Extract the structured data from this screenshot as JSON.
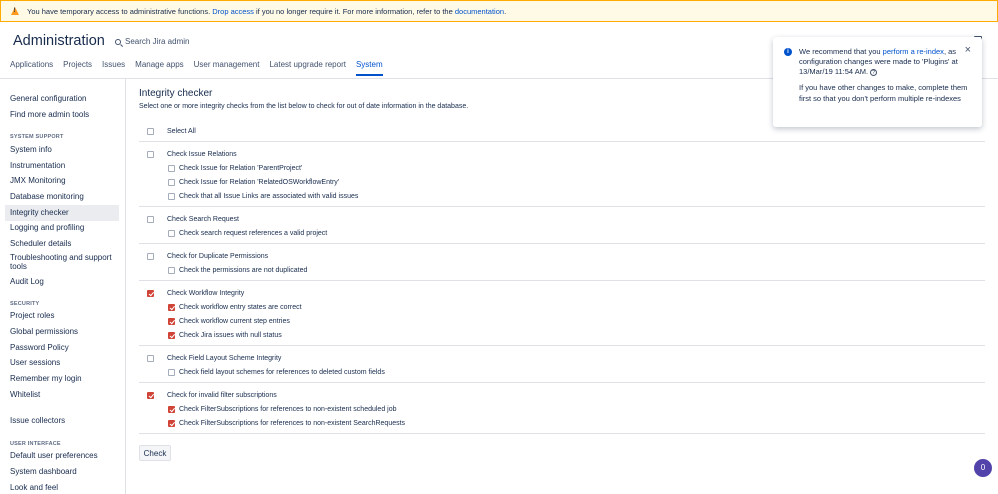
{
  "banner": {
    "icon": "warning-icon",
    "text_before": "You have temporary access to administrative functions. ",
    "link_drop": "Drop access",
    "text_middle": " if you no longer require it. For more information, refer to the ",
    "link_docs": "documentation",
    "text_after": "."
  },
  "header": {
    "title": "Administration",
    "search_label": "Search Jira admin",
    "tabs": [
      "Applications",
      "Projects",
      "Issues",
      "Manage apps",
      "User management",
      "Latest upgrade report",
      "System"
    ]
  },
  "sidebar": {
    "top_items": [
      "General configuration",
      "Find more admin tools"
    ],
    "system_support_heading": "SYSTEM SUPPORT",
    "system_support_items": [
      "System info",
      "Instrumentation",
      "JMX Monitoring",
      "Database monitoring",
      "Integrity checker",
      "Logging and profiling",
      "Scheduler details",
      "Troubleshooting and support tools",
      "Audit Log"
    ],
    "security_heading": "SECURITY",
    "security_items": [
      "Project roles",
      "Global permissions",
      "Password Policy",
      "User sessions",
      "Remember my login",
      "Whitelist"
    ],
    "issue_collectors": "Issue collectors",
    "user_interface_heading": "USER INTERFACE",
    "user_interface_items": [
      "Default user preferences",
      "System dashboard",
      "Look and feel"
    ]
  },
  "main": {
    "title": "Integrity checker",
    "description": "Select one or more integrity checks from the list below to check for out of date information in the database.",
    "select_all": "Select All",
    "groups": [
      {
        "label": "Check Issue Relations",
        "checked": false,
        "subs": [
          {
            "label": "Check Issue for Relation 'ParentProject'",
            "checked": false
          },
          {
            "label": "Check Issue for Relation 'RelatedOSWorkflowEntry'",
            "checked": false
          },
          {
            "label": "Check that all Issue Links are associated with valid issues",
            "checked": false
          }
        ]
      },
      {
        "label": "Check Search Request",
        "checked": false,
        "subs": [
          {
            "label": "Check search request references a valid project",
            "checked": false
          }
        ]
      },
      {
        "label": "Check for Duplicate Permissions",
        "checked": false,
        "subs": [
          {
            "label": "Check the permissions are not duplicated",
            "checked": false
          }
        ]
      },
      {
        "label": "Check Workflow Integrity",
        "checked": true,
        "subs": [
          {
            "label": "Check workflow entry states are correct",
            "checked": true
          },
          {
            "label": "Check workflow current step entries",
            "checked": true
          },
          {
            "label": "Check Jira issues with null status",
            "checked": true
          }
        ]
      },
      {
        "label": "Check Field Layout Scheme Integrity",
        "checked": false,
        "subs": [
          {
            "label": "Check field layout schemes for references to deleted custom fields",
            "checked": false
          }
        ]
      },
      {
        "label": "Check for invalid filter subscriptions",
        "checked": true,
        "subs": [
          {
            "label": "Check FilterSubscriptions for references to non-existent scheduled job",
            "checked": true
          },
          {
            "label": "Check FilterSubscriptions for references to non-existent SearchRequests",
            "checked": true
          }
        ]
      }
    ],
    "check_button": "Check"
  },
  "flag": {
    "icon": "info-icon",
    "p1_before": "We recommend that you ",
    "p1_link": "perform a re-index",
    "p1_after": ", as configuration changes were made to 'Plugins' at 13/Mar/19 11:54 AM.",
    "help_glyph": "?",
    "p2": "If you have other changes to make, complete them first so that you don't perform multiple re-indexes",
    "close_glyph": "×"
  },
  "avatar": "0",
  "colors": {
    "checked": "#d04437",
    "link": "#0052cc",
    "banner_bg": "#fffae6"
  }
}
